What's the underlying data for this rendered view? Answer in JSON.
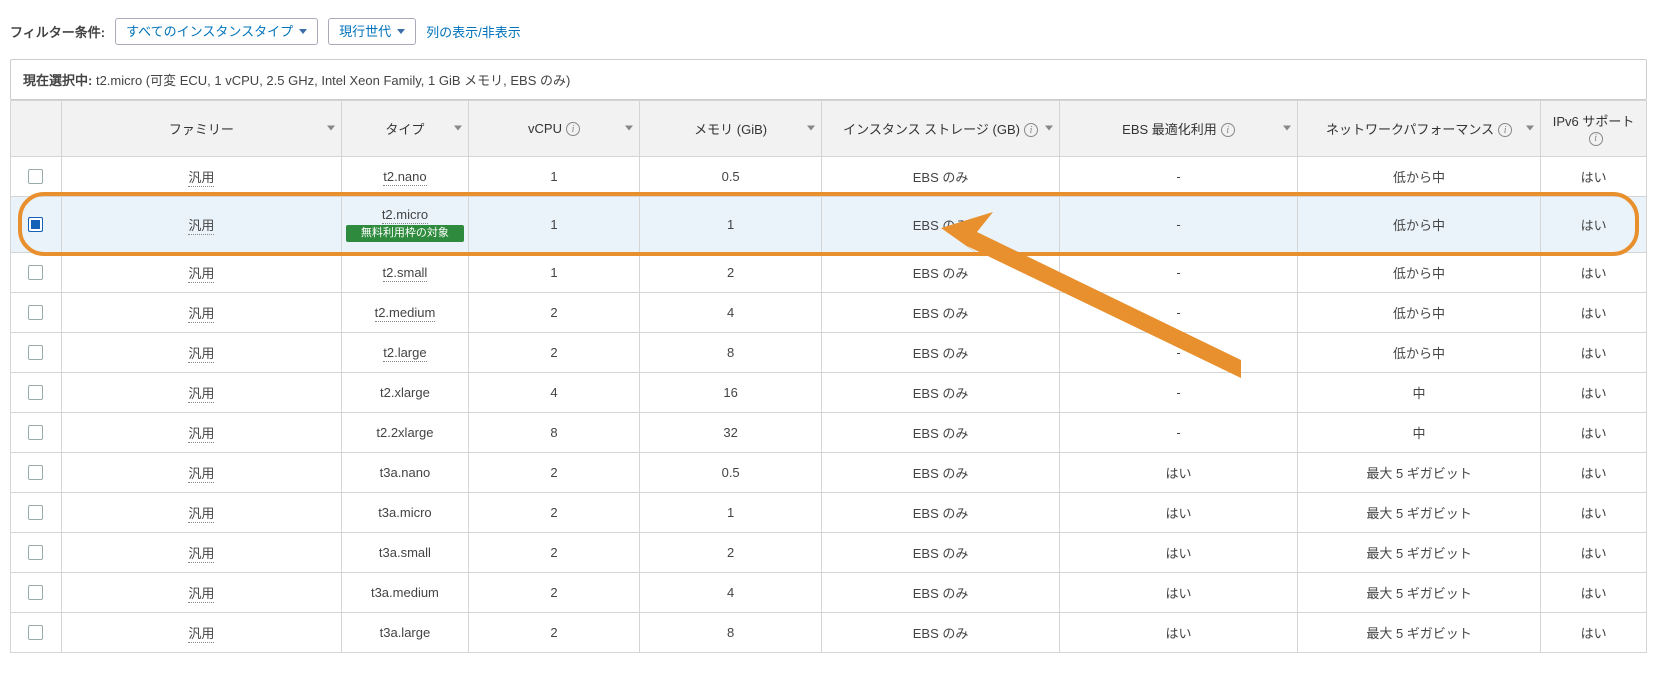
{
  "filter": {
    "label": "フィルター条件:",
    "instance_type_dd": "すべてのインスタンスタイプ",
    "generation_dd": "現行世代",
    "columns_link": "列の表示/非表示"
  },
  "selection_banner": {
    "prefix": "現在選択中: ",
    "text": "t2.micro (可変 ECU, 1 vCPU, 2.5 GHz, Intel Xeon Family, 1 GiB メモリ, EBS のみ)"
  },
  "headers": {
    "family": "ファミリー",
    "type": "タイプ",
    "vcpu": "vCPU",
    "memory": "メモリ (GiB)",
    "storage": "インスタンス ストレージ (GB)",
    "ebs": "EBS 最適化利用",
    "network": "ネットワークパフォーマンス",
    "ipv6": "IPv6 サポート"
  },
  "free_tier_label": "無料利用枠の対象",
  "rows": [
    {
      "selected": false,
      "family": "汎用",
      "type": "t2.nano",
      "free": false,
      "vcpu": "1",
      "memory": "0.5",
      "storage": "EBS のみ",
      "ebs": "-",
      "network": "低から中",
      "ipv6": "はい"
    },
    {
      "selected": true,
      "family": "汎用",
      "type": "t2.micro",
      "free": true,
      "vcpu": "1",
      "memory": "1",
      "storage": "EBS のみ",
      "ebs": "-",
      "network": "低から中",
      "ipv6": "はい"
    },
    {
      "selected": false,
      "family": "汎用",
      "type": "t2.small",
      "free": false,
      "vcpu": "1",
      "memory": "2",
      "storage": "EBS のみ",
      "ebs": "-",
      "network": "低から中",
      "ipv6": "はい"
    },
    {
      "selected": false,
      "family": "汎用",
      "type": "t2.medium",
      "free": false,
      "vcpu": "2",
      "memory": "4",
      "storage": "EBS のみ",
      "ebs": "-",
      "network": "低から中",
      "ipv6": "はい"
    },
    {
      "selected": false,
      "family": "汎用",
      "type": "t2.large",
      "free": false,
      "vcpu": "2",
      "memory": "8",
      "storage": "EBS のみ",
      "ebs": "-",
      "network": "低から中",
      "ipv6": "はい"
    },
    {
      "selected": false,
      "family": "汎用",
      "type": "t2.xlarge",
      "free": false,
      "vcpu": "4",
      "memory": "16",
      "storage": "EBS のみ",
      "ebs": "-",
      "network": "中",
      "ipv6": "はい"
    },
    {
      "selected": false,
      "family": "汎用",
      "type": "t2.2xlarge",
      "free": false,
      "vcpu": "8",
      "memory": "32",
      "storage": "EBS のみ",
      "ebs": "-",
      "network": "中",
      "ipv6": "はい"
    },
    {
      "selected": false,
      "family": "汎用",
      "type": "t3a.nano",
      "free": false,
      "vcpu": "2",
      "memory": "0.5",
      "storage": "EBS のみ",
      "ebs": "はい",
      "network": "最大 5 ギガビット",
      "ipv6": "はい"
    },
    {
      "selected": false,
      "family": "汎用",
      "type": "t3a.micro",
      "free": false,
      "vcpu": "2",
      "memory": "1",
      "storage": "EBS のみ",
      "ebs": "はい",
      "network": "最大 5 ギガビット",
      "ipv6": "はい"
    },
    {
      "selected": false,
      "family": "汎用",
      "type": "t3a.small",
      "free": false,
      "vcpu": "2",
      "memory": "2",
      "storage": "EBS のみ",
      "ebs": "はい",
      "network": "最大 5 ギガビット",
      "ipv6": "はい"
    },
    {
      "selected": false,
      "family": "汎用",
      "type": "t3a.medium",
      "free": false,
      "vcpu": "2",
      "memory": "4",
      "storage": "EBS のみ",
      "ebs": "はい",
      "network": "最大 5 ギガビット",
      "ipv6": "はい"
    },
    {
      "selected": false,
      "family": "汎用",
      "type": "t3a.large",
      "free": false,
      "vcpu": "2",
      "memory": "8",
      "storage": "EBS のみ",
      "ebs": "はい",
      "network": "最大 5 ギガビット",
      "ipv6": "はい"
    }
  ]
}
